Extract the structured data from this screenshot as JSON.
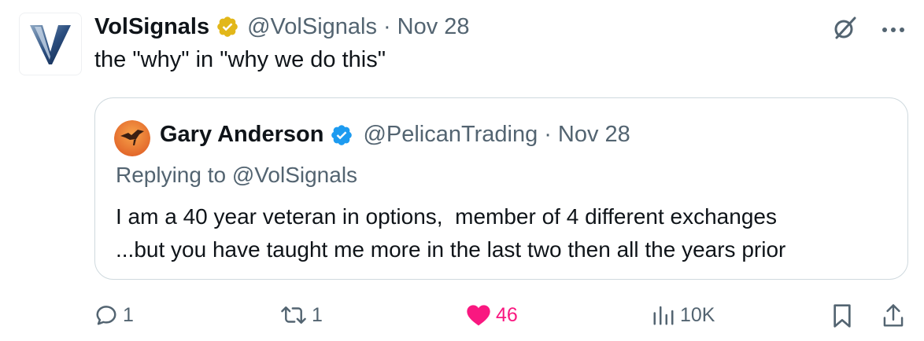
{
  "tweet": {
    "author": {
      "name": "VolSignals",
      "handle": "@VolSignals",
      "avatar_letter": "V",
      "badge_color": "#e2b719"
    },
    "separator": "·",
    "date": "Nov 28",
    "text": "the \"why\" in \"why we do this\"",
    "top_icons": [
      "grok-icon",
      "more-icon"
    ]
  },
  "quote": {
    "author": {
      "name": "Gary Anderson",
      "handle": "@PelicanTrading",
      "badge_color": "#1d9bf0"
    },
    "separator": "·",
    "date": "Nov 28",
    "replying_to": "Replying to @VolSignals",
    "body_line1": "I am a 40 year veteran in options,  member of 4 different exchanges",
    "body_line2": "...but you have taught me more in the last two then all the years prior"
  },
  "actions": {
    "replies": "1",
    "reposts": "1",
    "likes": "46",
    "views": "10K"
  },
  "colors": {
    "text": "#0f1419",
    "secondary": "#536471",
    "border": "#cfd9de",
    "like": "#f91880"
  }
}
